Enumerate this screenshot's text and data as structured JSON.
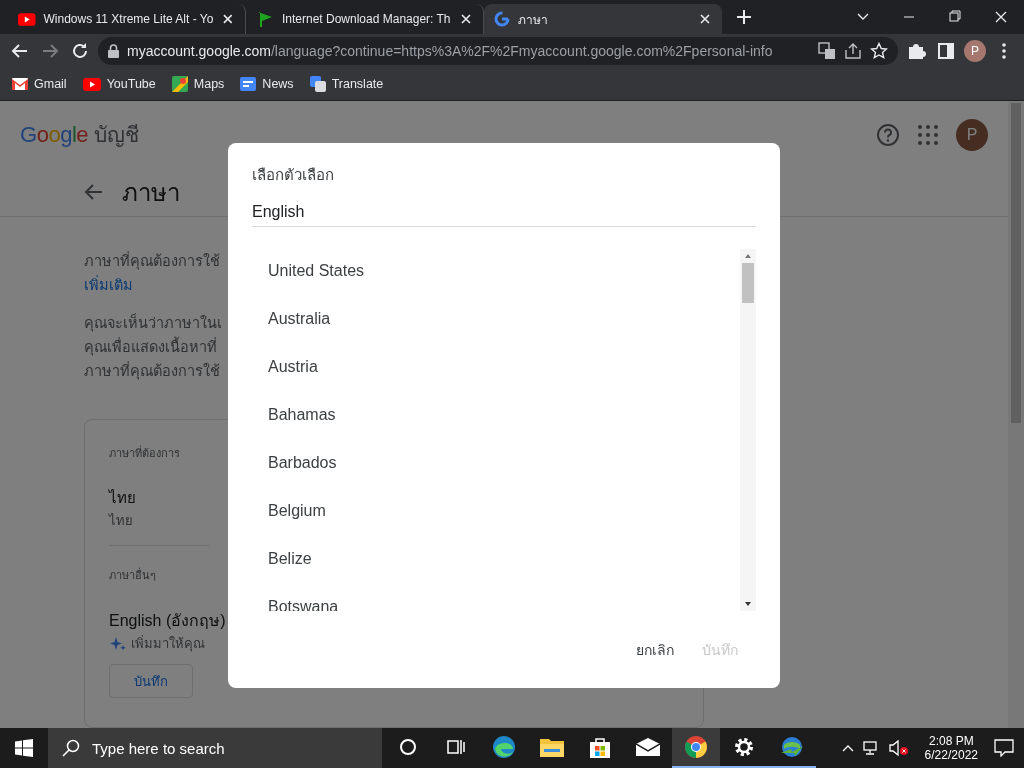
{
  "browser": {
    "tabs": [
      {
        "kind": "youtube",
        "title": "Windows 11 Xtreme Lite Alt - Yo",
        "selected": false
      },
      {
        "kind": "flag",
        "title": "Internet Download Manager: Th",
        "selected": false
      },
      {
        "kind": "google",
        "title": "ภาษา",
        "selected": true
      }
    ],
    "address": {
      "host": "myaccount.google.com",
      "path": "/language?continue=https%3A%2F%2Fmyaccount.google.com%2Fpersonal-info"
    },
    "profile_initial": "P",
    "bookmarks": [
      {
        "kind": "gmail",
        "label": "Gmail"
      },
      {
        "kind": "youtube",
        "label": "YouTube"
      },
      {
        "kind": "maps",
        "label": "Maps"
      },
      {
        "kind": "news",
        "label": "News"
      },
      {
        "kind": "translate",
        "label": "Translate"
      }
    ]
  },
  "page": {
    "logo": "Google",
    "product": "บัญชี",
    "avatar_initial": "P",
    "title": "ภาษา",
    "intro": "ภาษาที่คุณต้องการใช้",
    "more_link": "เพิ่มเติม",
    "paragraph_lines": [
      "คุณจะเห็นว่าภาษาในเ",
      "คุณเพื่อแสดงเนื้อหาที่",
      "ภาษาที่คุณต้องการใช้"
    ],
    "card": {
      "preferred_heading": "ภาษาที่ต้องการ",
      "preferred_name": "ไทย",
      "preferred_native": "ไทย",
      "other_heading": "ภาษาอื่นๆ",
      "other_name": "English (อังกฤษ)",
      "suggested": "เพิ่มมาให้คุณ",
      "save": "บันทึก"
    }
  },
  "dialog": {
    "title": "เลือกตัวเลือก",
    "search_value": "English",
    "options": [
      "United States",
      "Australia",
      "Austria",
      "Bahamas",
      "Barbados",
      "Belgium",
      "Belize",
      "Botswana"
    ],
    "cancel": "ยกเลิก",
    "save": {
      "label": "บันทึก",
      "disabled": true
    }
  },
  "taskbar": {
    "search_placeholder": "Type here to search",
    "apps": [
      {
        "kind": "cortana",
        "selected": false,
        "running": false
      },
      {
        "kind": "taskview",
        "selected": false,
        "running": false
      },
      {
        "kind": "edge",
        "selected": false,
        "running": false
      },
      {
        "kind": "explorer",
        "selected": false,
        "running": false
      },
      {
        "kind": "store",
        "selected": false,
        "running": false
      },
      {
        "kind": "mail",
        "selected": false,
        "running": false
      },
      {
        "kind": "chrome",
        "selected": true,
        "running": true
      },
      {
        "kind": "settings",
        "selected": false,
        "running": true
      },
      {
        "kind": "idm",
        "selected": false,
        "running": true
      }
    ],
    "time": "2:08 PM",
    "date": "6/22/2022"
  }
}
